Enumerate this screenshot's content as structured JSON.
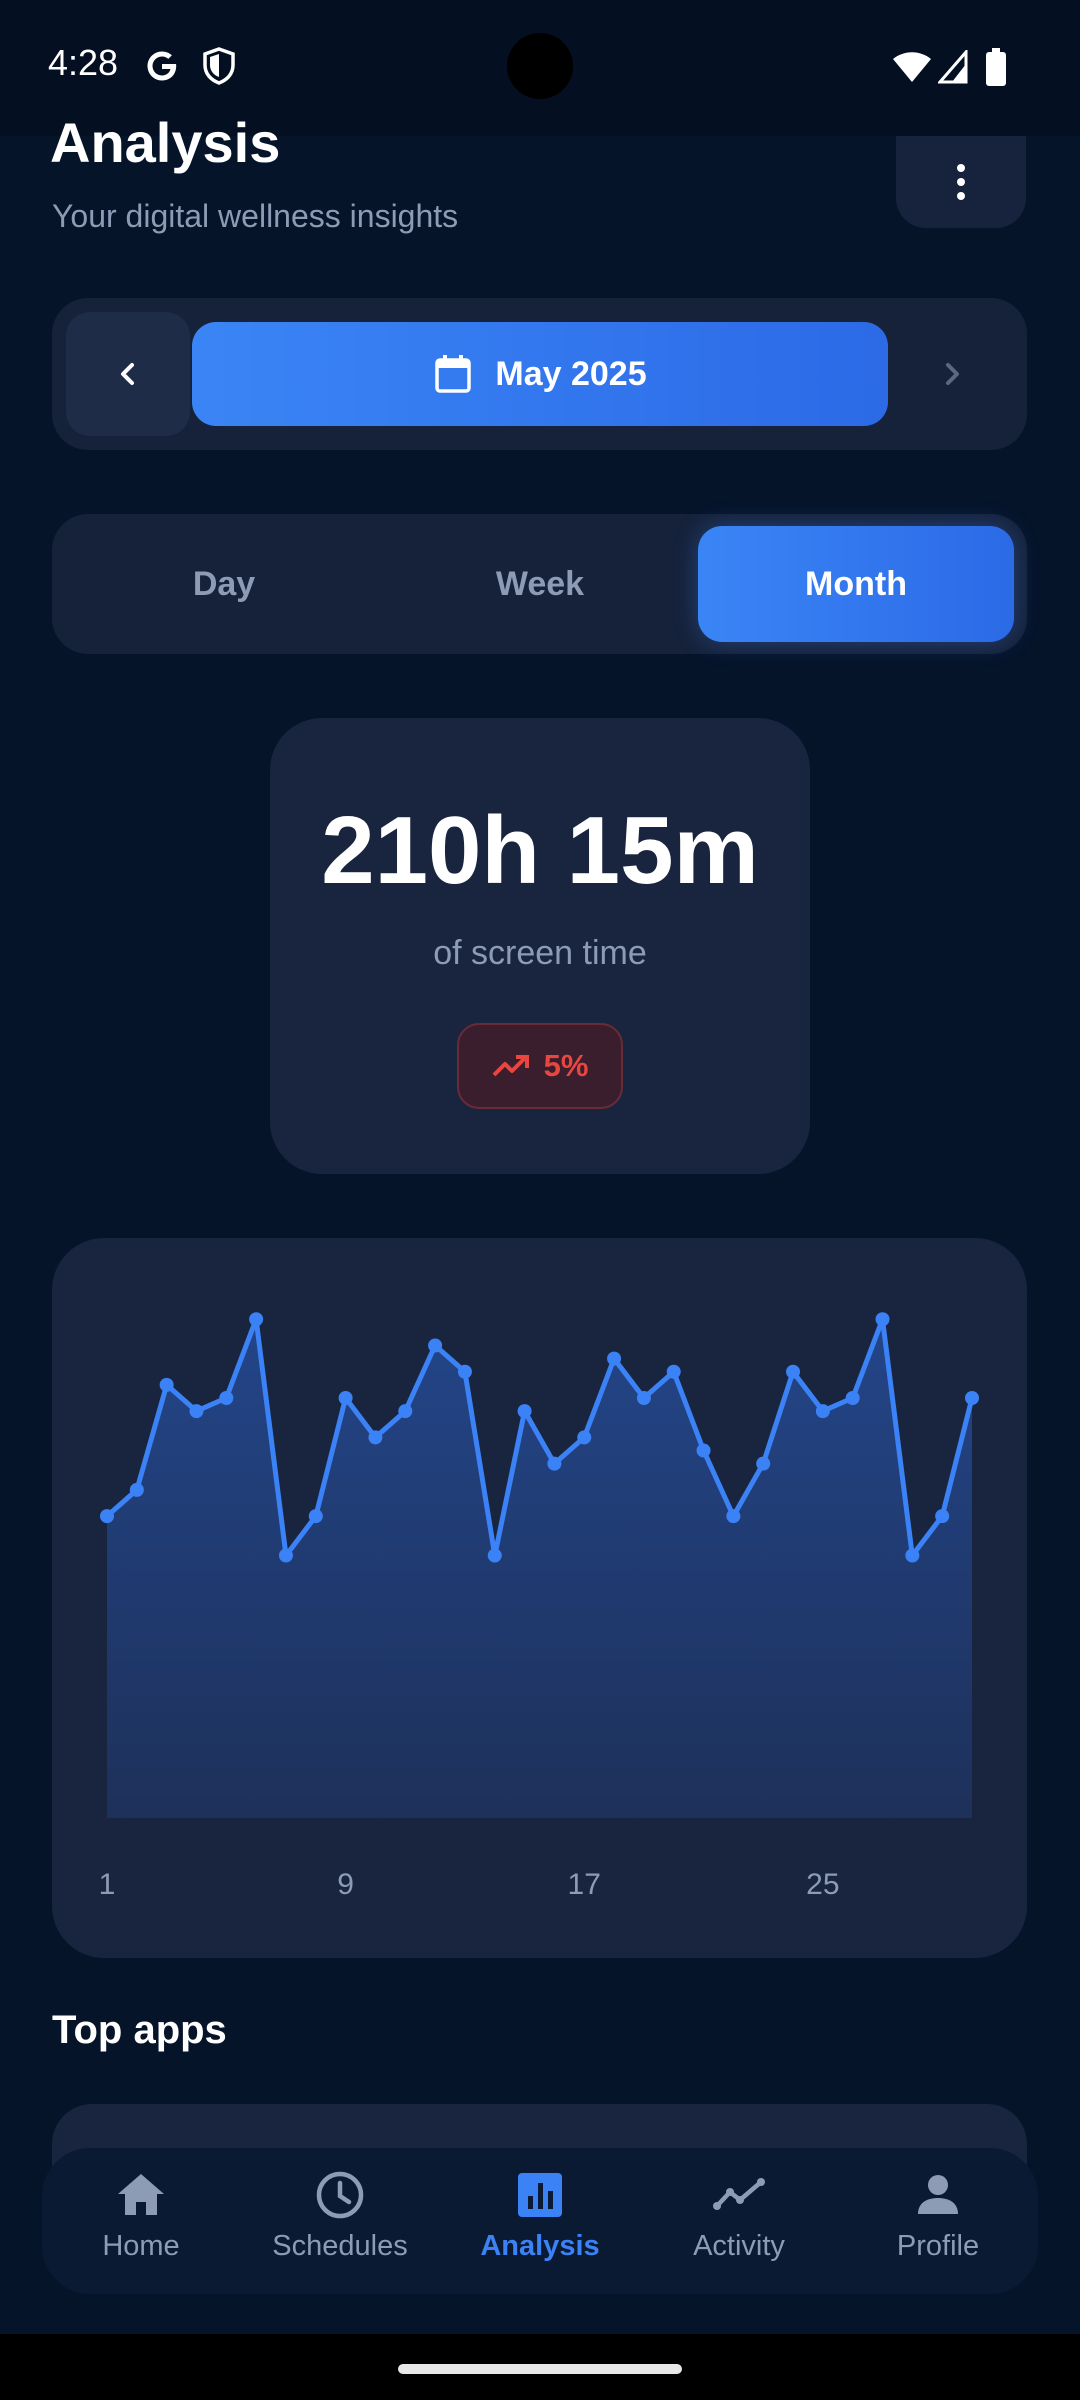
{
  "status_bar": {
    "time": "4:28",
    "icons": [
      "google-g-icon",
      "shield-icon",
      "wifi-icon",
      "signal-icon",
      "battery-icon"
    ]
  },
  "header": {
    "title": "Analysis",
    "subtitle": "Your digital wellness insights",
    "menu_icon": "more-vert-icon"
  },
  "period_selector": {
    "prev_icon": "chevron-left-icon",
    "calendar_icon": "calendar-icon",
    "label": "May 2025",
    "next_icon": "chevron-right-icon"
  },
  "tabs": [
    {
      "label": "Day",
      "active": false
    },
    {
      "label": "Week",
      "active": false
    },
    {
      "label": "Month",
      "active": true
    }
  ],
  "summary": {
    "total": "210h 15m",
    "caption": "of screen time",
    "change": "5%",
    "change_icon": "trending-up-icon",
    "change_color": "#e8463f"
  },
  "chart_data": {
    "type": "area",
    "x": [
      1,
      2,
      3,
      4,
      5,
      6,
      7,
      8,
      9,
      10,
      11,
      12,
      13,
      14,
      15,
      16,
      17,
      18,
      19,
      20,
      21,
      22,
      23,
      24,
      25,
      26,
      27,
      28,
      29,
      30
    ],
    "x_tick_labels": [
      "1",
      "9",
      "17",
      "25"
    ],
    "values": [
      35,
      37,
      45,
      43,
      44,
      50,
      32,
      35,
      44,
      41,
      43,
      48,
      46,
      32,
      43,
      39,
      41,
      47,
      44,
      46,
      40,
      35,
      39,
      46,
      43,
      44,
      50,
      32,
      35,
      44
    ],
    "ylim": [
      12,
      52
    ],
    "color": "#3b82f6"
  },
  "top_apps": {
    "title": "Top apps"
  },
  "bottom_nav": [
    {
      "label": "Home",
      "icon": "home-icon",
      "active": false
    },
    {
      "label": "Schedules",
      "icon": "clock-icon",
      "active": false
    },
    {
      "label": "Analysis",
      "icon": "bar-chart-icon",
      "active": true
    },
    {
      "label": "Activity",
      "icon": "activity-line-icon",
      "active": false
    },
    {
      "label": "Profile",
      "icon": "person-icon",
      "active": false
    }
  ],
  "colors": {
    "background": "#06142a",
    "card": "#19253f",
    "accent": "#3b82f6",
    "muted_text": "#8d9bb5"
  }
}
